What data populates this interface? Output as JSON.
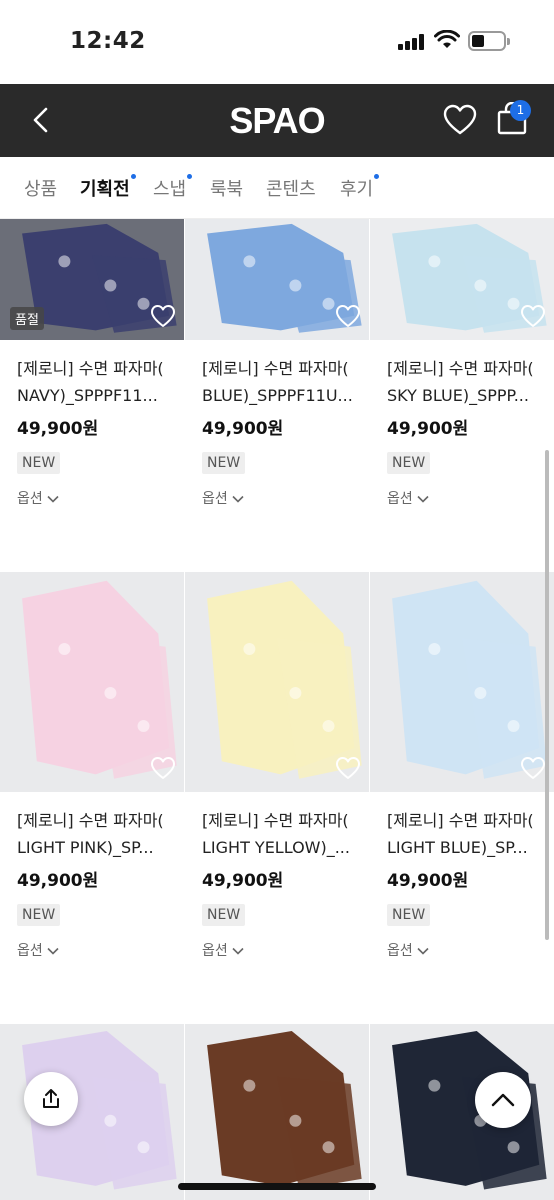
{
  "status_bar": {
    "time": "12:42"
  },
  "header": {
    "logo": "SPAO",
    "cart_count": "1"
  },
  "tabs": [
    {
      "label": "상품",
      "dot": false,
      "active": false
    },
    {
      "label": "기획전",
      "dot": true,
      "active": true
    },
    {
      "label": "스냅",
      "dot": true,
      "active": false
    },
    {
      "label": "룩북",
      "dot": false,
      "active": false
    },
    {
      "label": "콘텐츠",
      "dot": false,
      "active": false
    },
    {
      "label": "후기",
      "dot": true,
      "active": false
    }
  ],
  "products": [
    {
      "line1": "[제로니] 수면 파자마(",
      "line2": "NAVY)_SPPPF11...",
      "price": "49,900원",
      "badge": "NEW",
      "option": "옵션",
      "sold_out": "품절",
      "color": "#3b3f6e",
      "bg": "#6b6e78"
    },
    {
      "line1": "[제로니] 수면 파자마(",
      "line2": "BLUE)_SPPPF11U...",
      "price": "49,900원",
      "badge": "NEW",
      "option": "옵션",
      "sold_out": "",
      "color": "#7ea8de",
      "bg": "#e8eaed"
    },
    {
      "line1": "[제로니] 수면 파자마(",
      "line2": "SKY BLUE)_SPPP...",
      "price": "49,900원",
      "badge": "NEW",
      "option": "옵션",
      "sold_out": "",
      "color": "#c6e2ee",
      "bg": "#ecedef"
    },
    {
      "line1": "[제로니] 수면 파자마(",
      "line2": "LIGHT PINK)_SP...",
      "price": "49,900원",
      "badge": "NEW",
      "option": "옵션",
      "sold_out": "",
      "color": "#f6d2e2",
      "bg": "#e9eaec"
    },
    {
      "line1": "[제로니] 수면 파자마(",
      "line2": "LIGHT YELLOW)_...",
      "price": "49,900원",
      "badge": "NEW",
      "option": "옵션",
      "sold_out": "",
      "color": "#f8f1bf",
      "bg": "#e9eaec"
    },
    {
      "line1": "[제로니] 수면 파자마(",
      "line2": "LIGHT BLUE)_SP...",
      "price": "49,900원",
      "badge": "NEW",
      "option": "옵션",
      "sold_out": "",
      "color": "#cfe4f4",
      "bg": "#e9eaec"
    },
    {
      "color": "#ddd0ee",
      "bg": "#e9eaec"
    },
    {
      "color": "#6a3b25",
      "bg": "#e9eaec"
    },
    {
      "color": "#1f2636",
      "bg": "#e9eaec"
    }
  ]
}
